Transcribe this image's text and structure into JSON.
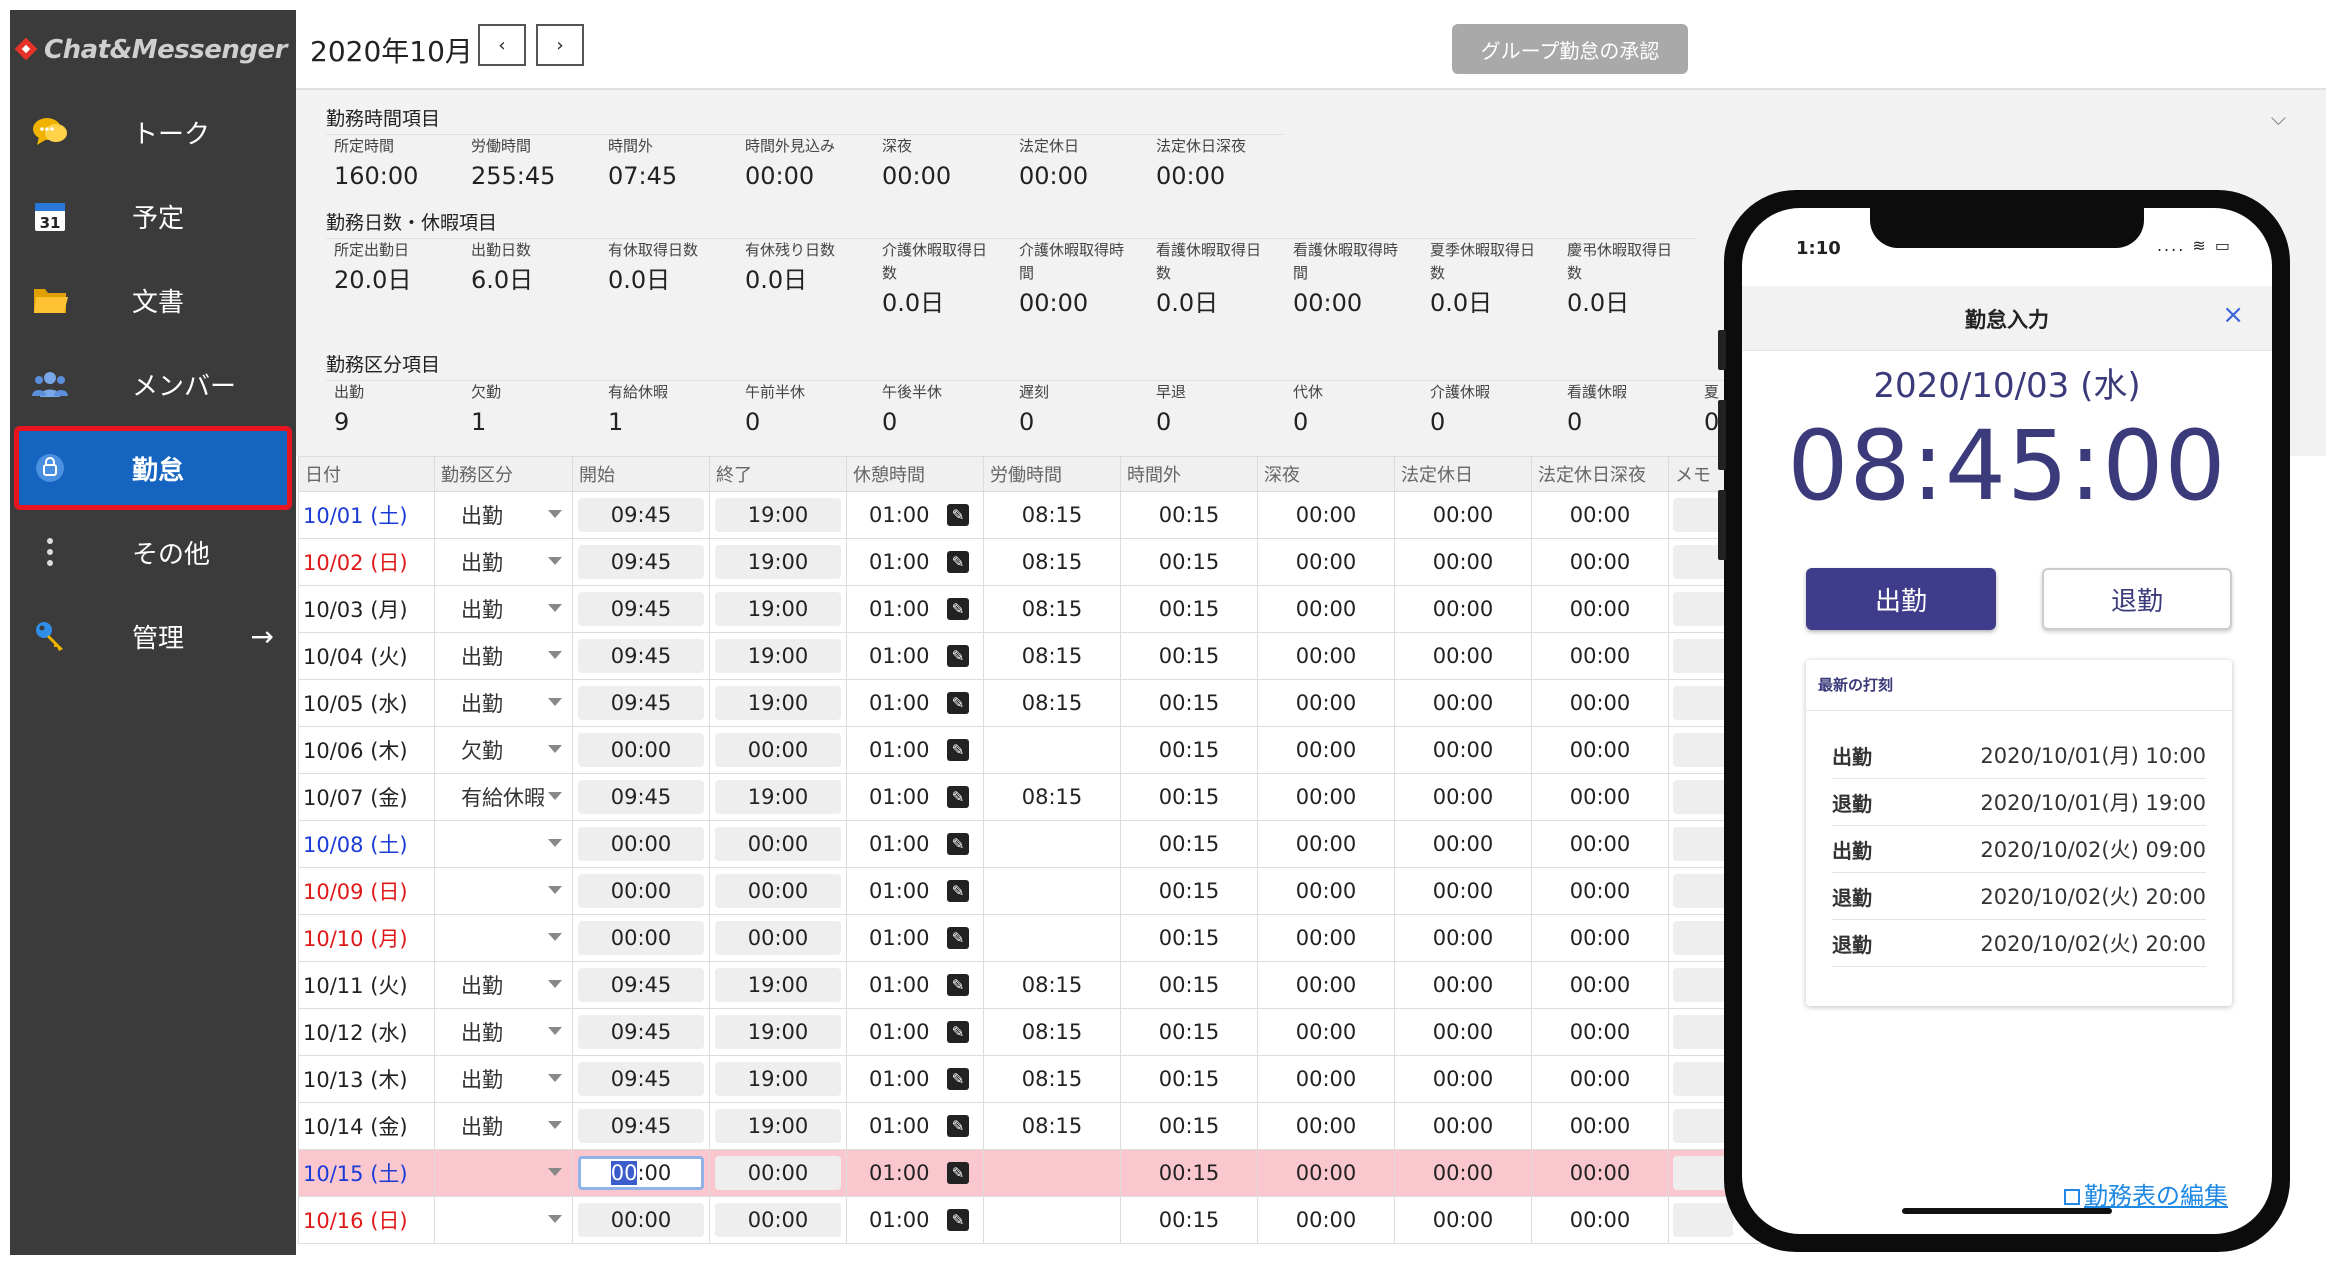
{
  "app": {
    "logo_text": "Chat&Messenger",
    "accent": "#1565c0",
    "highlight": "#e8141e"
  },
  "sidebar": {
    "items": [
      {
        "label": "トーク",
        "icon": "chat-bubbles-icon"
      },
      {
        "label": "予定",
        "icon": "calendar-31-icon"
      },
      {
        "label": "文書",
        "icon": "folder-icon"
      },
      {
        "label": "メンバー",
        "icon": "members-icon"
      },
      {
        "label": "勤怠",
        "icon": "lock-clock-icon",
        "active": true
      },
      {
        "label": "その他",
        "icon": "more-vertical-icon"
      },
      {
        "label": "管理",
        "icon": "key-icon",
        "arrow": "→"
      }
    ]
  },
  "header": {
    "month": "2020年10月",
    "prev": "‹",
    "next": "›",
    "approve_label": "グループ勤怠の承認"
  },
  "summary": {
    "work_hours": {
      "title": "勤務時間項目",
      "items": [
        {
          "label": "所定時間",
          "value": "160:00"
        },
        {
          "label": "労働時間",
          "value": "255:45"
        },
        {
          "label": "時間外",
          "value": "07:45"
        },
        {
          "label": "時間外見込み",
          "value": "00:00"
        },
        {
          "label": "深夜",
          "value": "00:00"
        },
        {
          "label": "法定休日",
          "value": "00:00"
        },
        {
          "label": "法定休日深夜",
          "value": "00:00"
        }
      ]
    },
    "work_days": {
      "title": "勤務日数・休暇項目",
      "items": [
        {
          "label": "所定出勤日",
          "value": "20.0日"
        },
        {
          "label": "出勤日数",
          "value": "6.0日"
        },
        {
          "label": "有休取得日数",
          "value": "0.0日"
        },
        {
          "label": "有休残り日数",
          "value": "0.0日"
        },
        {
          "label": "介護休暇取得日数",
          "value": "0.0日"
        },
        {
          "label": "介護休暇取得時間",
          "value": "00:00"
        },
        {
          "label": "看護休暇取得日数",
          "value": "0.0日"
        },
        {
          "label": "看護休暇取得時間",
          "value": "00:00"
        },
        {
          "label": "夏季休暇取得日数",
          "value": "0.0日"
        },
        {
          "label": "慶弔休暇取得日数",
          "value": "0.0日"
        }
      ]
    },
    "work_types": {
      "title": "勤務区分項目",
      "items": [
        {
          "label": "出勤",
          "value": "9"
        },
        {
          "label": "欠勤",
          "value": "1"
        },
        {
          "label": "有給休暇",
          "value": "1"
        },
        {
          "label": "午前半休",
          "value": "0"
        },
        {
          "label": "午後半休",
          "value": "0"
        },
        {
          "label": "遅刻",
          "value": "0"
        },
        {
          "label": "早退",
          "value": "0"
        },
        {
          "label": "代休",
          "value": "0"
        },
        {
          "label": "介護休暇",
          "value": "0"
        },
        {
          "label": "看護休暇",
          "value": "0"
        },
        {
          "label": "夏",
          "value": "0"
        }
      ]
    }
  },
  "table": {
    "columns": [
      "日付",
      "勤務区分",
      "開始",
      "終了",
      "休憩時間",
      "労働時間",
      "時間外",
      "深夜",
      "法定休日",
      "法定休日深夜",
      "メモ"
    ],
    "rows": [
      {
        "date": "10/01 (土)",
        "color": "blue",
        "kubun": "出勤",
        "start": "09:45",
        "end": "19:00",
        "break": "01:00",
        "work": "08:15",
        "overtime": "00:15",
        "night": "00:00",
        "holiday": "00:00",
        "holiday_night": "00:00"
      },
      {
        "date": "10/02 (日)",
        "color": "red",
        "kubun": "出勤",
        "start": "09:45",
        "end": "19:00",
        "break": "01:00",
        "work": "08:15",
        "overtime": "00:15",
        "night": "00:00",
        "holiday": "00:00",
        "holiday_night": "00:00"
      },
      {
        "date": "10/03 (月)",
        "color": "black",
        "kubun": "出勤",
        "start": "09:45",
        "end": "19:00",
        "break": "01:00",
        "work": "08:15",
        "overtime": "00:15",
        "night": "00:00",
        "holiday": "00:00",
        "holiday_night": "00:00"
      },
      {
        "date": "10/04 (火)",
        "color": "black",
        "kubun": "出勤",
        "start": "09:45",
        "end": "19:00",
        "break": "01:00",
        "work": "08:15",
        "overtime": "00:15",
        "night": "00:00",
        "holiday": "00:00",
        "holiday_night": "00:00"
      },
      {
        "date": "10/05 (水)",
        "color": "black",
        "kubun": "出勤",
        "start": "09:45",
        "end": "19:00",
        "break": "01:00",
        "work": "08:15",
        "overtime": "00:15",
        "night": "00:00",
        "holiday": "00:00",
        "holiday_night": "00:00"
      },
      {
        "date": "10/06 (木)",
        "color": "black",
        "kubun": "欠勤",
        "start": "00:00",
        "end": "00:00",
        "break": "01:00",
        "work": "",
        "overtime": "00:15",
        "night": "00:00",
        "holiday": "00:00",
        "holiday_night": "00:00"
      },
      {
        "date": "10/07 (金)",
        "color": "black",
        "kubun": "有給休暇",
        "start": "09:45",
        "end": "19:00",
        "break": "01:00",
        "work": "08:15",
        "overtime": "00:15",
        "night": "00:00",
        "holiday": "00:00",
        "holiday_night": "00:00"
      },
      {
        "date": "10/08 (土)",
        "color": "blue",
        "kubun": "",
        "start": "00:00",
        "end": "00:00",
        "break": "01:00",
        "work": "",
        "overtime": "00:15",
        "night": "00:00",
        "holiday": "00:00",
        "holiday_night": "00:00"
      },
      {
        "date": "10/09 (日)",
        "color": "red",
        "kubun": "",
        "start": "00:00",
        "end": "00:00",
        "break": "01:00",
        "work": "",
        "overtime": "00:15",
        "night": "00:00",
        "holiday": "00:00",
        "holiday_night": "00:00"
      },
      {
        "date": "10/10 (月)",
        "color": "red",
        "kubun": "",
        "start": "00:00",
        "end": "00:00",
        "break": "01:00",
        "work": "",
        "overtime": "00:15",
        "night": "00:00",
        "holiday": "00:00",
        "holiday_night": "00:00"
      },
      {
        "date": "10/11 (火)",
        "color": "black",
        "kubun": "出勤",
        "start": "09:45",
        "end": "19:00",
        "break": "01:00",
        "work": "08:15",
        "overtime": "00:15",
        "night": "00:00",
        "holiday": "00:00",
        "holiday_night": "00:00"
      },
      {
        "date": "10/12 (水)",
        "color": "black",
        "kubun": "出勤",
        "start": "09:45",
        "end": "19:00",
        "break": "01:00",
        "work": "08:15",
        "overtime": "00:15",
        "night": "00:00",
        "holiday": "00:00",
        "holiday_night": "00:00"
      },
      {
        "date": "10/13 (木)",
        "color": "black",
        "kubun": "出勤",
        "start": "09:45",
        "end": "19:00",
        "break": "01:00",
        "work": "08:15",
        "overtime": "00:15",
        "night": "00:00",
        "holiday": "00:00",
        "holiday_night": "00:00"
      },
      {
        "date": "10/14 (金)",
        "color": "black",
        "kubun": "出勤",
        "start": "09:45",
        "end": "19:00",
        "break": "01:00",
        "work": "08:15",
        "overtime": "00:15",
        "night": "00:00",
        "holiday": "00:00",
        "holiday_night": "00:00"
      },
      {
        "date": "10/15 (土)",
        "color": "blue",
        "kubun": "",
        "start": "00:00",
        "end": "00:00",
        "break": "01:00",
        "work": "",
        "overtime": "00:15",
        "night": "00:00",
        "holiday": "00:00",
        "holiday_night": "00:00",
        "highlight": true,
        "focus_prefix": "00",
        "focus_rest": ":00"
      },
      {
        "date": "10/16 (日)",
        "color": "red",
        "kubun": "",
        "start": "00:00",
        "end": "00:00",
        "break": "01:00",
        "work": "",
        "overtime": "00:15",
        "night": "00:00",
        "holiday": "00:00",
        "holiday_night": "00:00"
      }
    ]
  },
  "phone": {
    "status_time": "1:10",
    "status_icons": ".... ≋ ▭",
    "title": "勤怠入力",
    "close": "×",
    "date": "2020/10/03 (水)",
    "clock": "08:45:00",
    "btn_in": "出勤",
    "btn_out": "退勤",
    "recent_title": "最新の打刻",
    "recent": [
      {
        "type": "出勤",
        "time": "2020/10/01(月) 10:00"
      },
      {
        "type": "退勤",
        "time": "2020/10/01(月) 19:00"
      },
      {
        "type": "出勤",
        "time": "2020/10/02(火) 09:00"
      },
      {
        "type": "退勤",
        "time": "2020/10/02(火) 20:00"
      },
      {
        "type": "退勤",
        "time": "2020/10/02(火) 20:00"
      }
    ],
    "edit_link": "勤務表の編集"
  }
}
